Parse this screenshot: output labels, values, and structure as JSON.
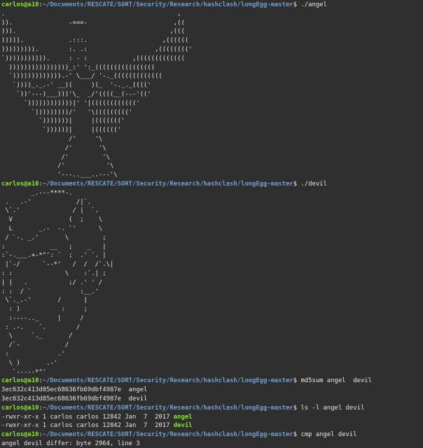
{
  "prompt": {
    "user_host": "carlos@a10",
    "separator": ":",
    "path": "~/Documents/RESCATE/SORT/Security/Research/hashclash/longEgg-master",
    "symbol": "$"
  },
  "commands": {
    "run_angel": "./angel",
    "run_devil": "./devil",
    "md5sum": "md5sum angel  devil",
    "ls": "ls -l angel devil",
    "cmp": "cmp angel devil"
  },
  "angel_art": [
    ".                                              ,",
    ")).               -===-                       ,((",
    "))).                                         ,(((",
    "))))).            .:::.                    ,((((((",
    "))))))))).        :. .:                  ,((((((((' ",
    "`))))))))))).     : - :            ,(((((((((((((",
    "  ))))))))))))))))_:' ':_((((((((((((((((",
    "  `))))))))))))).-' \\___/ '-._(((((((((((((",
    "   `))))_._.-' __)(     )(_  '-._._(((('",
    "    `))'---)___)))'\\_  _/'((((__(---'(('",
    "      `))))))))))))|' '|(((((((((((('",
    "        `)))))))))/'   '\\((((((((('",
    "          `)))))))|     |((((((('",
    "           `))))))|     |(((((('",
    "                  /'     '\\",
    "                 /'       '\\",
    "                /'         '\\",
    "               /'           '\\",
    "               '---..___..---'\\"
  ],
  "devil_art": [
    "        _.---****-.",
    " .   .-'            /|`.",
    " \\`.'              / |  `.",
    "  V               (  ;    \\",
    "  L       _.-  -. `'      \\",
    " / `-. _.'       \\         ;",
    ":            __   ;    _   |",
    ":`-.___.+-*\"': `  ;  .' `. |",
    " |`-/      `--*'   /  /  /`.\\|",
    ": :              \\    :`.| ;",
    "| |   .           ;/ .' ' /",
    ": :  / `             :__.'",
    " \\`._.-'       /      |",
    "  : )           :     ;",
    "  :----.._     |     /",
    " : .-.    `.        /",
    "  \\     `._       /",
    "  /`-            /",
    " :             .'",
    "  \\ )       .-'",
    "   `-----*\"'"
  ],
  "md5sum_output": [
    "3ec632c413d85ec68636fb69dbf4987e  angel",
    "3ec632c413d85ec68636fb69dbf4987e  devil"
  ],
  "ls_output": [
    {
      "perms": "-rwxr-xr-x 1 carlos carlos 12842 Jan  7  2017 ",
      "name": "angel"
    },
    {
      "perms": "-rwxr-xr-x 1 carlos carlos 12842 Jan  7  2017 ",
      "name": "devil"
    }
  ],
  "cmp_output": "angel devil differ: byte 2964, line 3",
  "colors": {
    "background": "#2f2f2f",
    "foreground": "#e6e6e6",
    "user_green": "#8ae234",
    "path_blue": "#729fcf"
  }
}
